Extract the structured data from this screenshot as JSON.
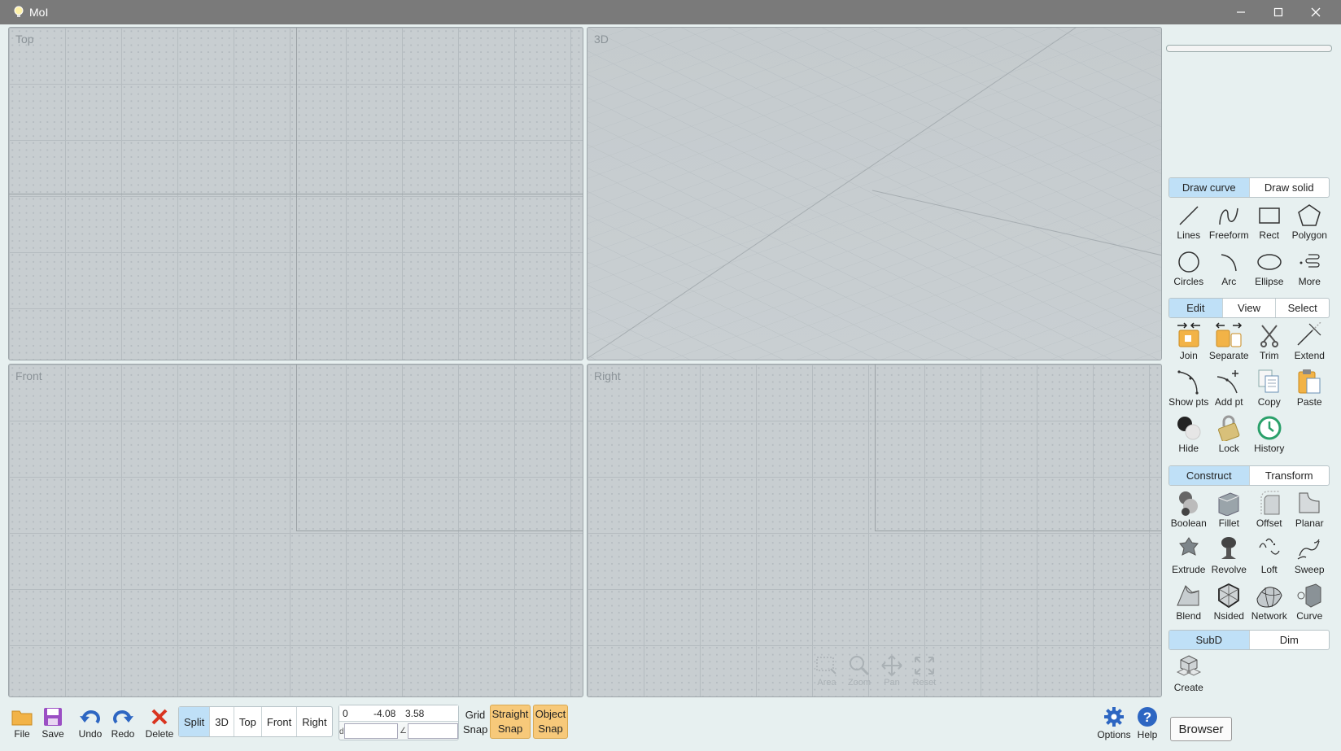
{
  "window": {
    "title": "MoI",
    "minimize": "—",
    "maximize": "☐",
    "close": "✕"
  },
  "viewports": {
    "top": "Top",
    "3d": "3D",
    "front": "Front",
    "right": "Right"
  },
  "view_nav": {
    "area": "Area",
    "zoom": "Zoom",
    "pan": "Pan",
    "reset": "Reset"
  },
  "toolbar": {
    "file": "File",
    "save": "Save",
    "undo": "Undo",
    "redo": "Redo",
    "delete": "Delete",
    "views": [
      "Split",
      "3D",
      "Top",
      "Front",
      "Right"
    ],
    "coords": {
      "x": "0",
      "y": "-4.08",
      "z": "3.58",
      "d_label": "d",
      "angle_label": "∠"
    },
    "grid_snap": [
      "Grid",
      "Snap"
    ],
    "straight_snap": [
      "Straight",
      "Snap"
    ],
    "object_snap": [
      "Object",
      "Snap"
    ],
    "options": "Options",
    "help": "Help",
    "browser": "Browser"
  },
  "panel": {
    "draw_tabs": [
      "Draw curve",
      "Draw solid"
    ],
    "draw_tools": [
      "Lines",
      "Freeform",
      "Rect",
      "Polygon",
      "Circles",
      "Arc",
      "Ellipse",
      "More"
    ],
    "edit_tabs": [
      "Edit",
      "View",
      "Select"
    ],
    "edit_tools": [
      "Join",
      "Separate",
      "Trim",
      "Extend",
      "Show pts",
      "Add pt",
      "Copy",
      "Paste",
      "Hide",
      "Lock",
      "History"
    ],
    "construct_tabs": [
      "Construct",
      "Transform"
    ],
    "construct_tools": [
      "Boolean",
      "Fillet",
      "Offset",
      "Planar",
      "Extrude",
      "Revolve",
      "Loft",
      "Sweep",
      "Blend",
      "Nsided",
      "Network",
      "Curve"
    ],
    "subd_tabs": [
      "SubD",
      "Dim"
    ],
    "subd_tools": [
      "Create"
    ]
  },
  "colors": {
    "accent_tab": "#bfe0f7",
    "snap_active": "#f7c97a",
    "viewport_bg": "#c8ced1",
    "app_bg": "#e7f0f0"
  }
}
